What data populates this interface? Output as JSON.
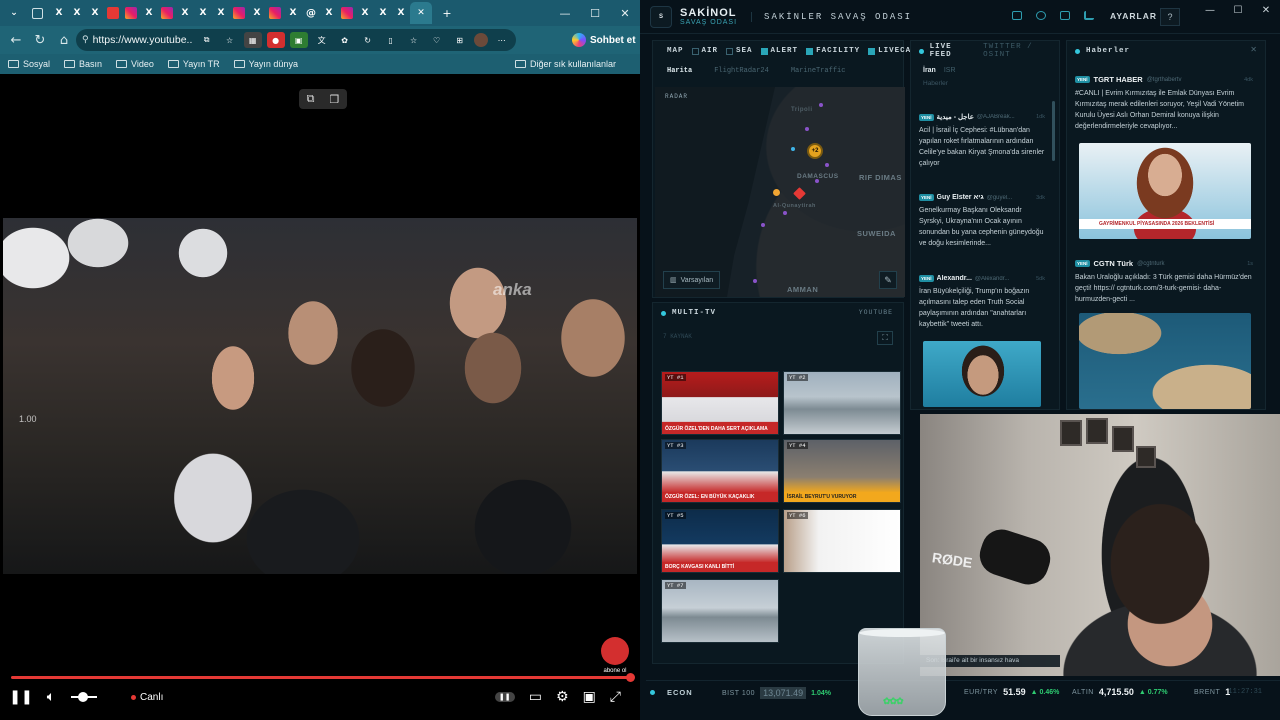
{
  "browser": {
    "tabs": [
      "window-menu",
      "workspaces",
      "x",
      "x",
      "x",
      "youtube",
      "instagram",
      "x",
      "instagram",
      "x",
      "x",
      "x",
      "instagram",
      "x",
      "instagram",
      "x",
      "threads",
      "x",
      "instagram",
      "x",
      "x",
      "x",
      "x",
      "x-active"
    ],
    "new_tab": "+",
    "window_controls": [
      "—",
      "☐",
      "✕"
    ],
    "url": "https://www.youtube...",
    "copilot_label": "Sohbet et",
    "bookmarks": [
      "Sosyal",
      "Basın",
      "Video",
      "Yayın TR",
      "Yayın dünya"
    ],
    "bookmarks_other": "Diğer sık kullanılanlar"
  },
  "video": {
    "speed_overlay": "1.00",
    "watermark": "anka",
    "logo_text": "abone ol",
    "live_label": "Canlı",
    "progress": 1.0,
    "volume": 0.45
  },
  "dashboard": {
    "brand": "SAKİNOL",
    "brand_sub": "SAVAŞ ODASI",
    "title": "SAKİNLER SAVAŞ ODASI",
    "settings": "AYARLAR",
    "help": "?",
    "map": {
      "title": "MAP",
      "filters": [
        {
          "label": "AIR",
          "on": false
        },
        {
          "label": "SEA",
          "on": false
        },
        {
          "label": "ALERT",
          "on": true
        },
        {
          "label": "FACILITY",
          "on": true
        },
        {
          "label": "LIVECAM",
          "on": true
        }
      ],
      "tabs": [
        "Harita",
        "FlightRadar24",
        "MarineTraffic"
      ],
      "radar_label": "RADAR",
      "cluster_label": "+2",
      "places": [
        "Tripoli",
        "DAMASCUS",
        "RIF DIMAS",
        "Al-Qunaytirah",
        "SUWEIDA",
        "AMMAN"
      ],
      "default_btn": "Varsayılan"
    },
    "multitv": {
      "title": "MULTI-TV",
      "source": "YOUTUBE",
      "count_label": "7 KAYNAK",
      "tiles": [
        {
          "tag": "YT #1",
          "strip": "ÖZGÜR ÖZEL'DEN DAHA SERT AÇIKLAMA"
        },
        {
          "tag": "YT #2",
          "strip": ""
        },
        {
          "tag": "YT #3",
          "strip": "ÖZGÜR ÖZEL: EN BÜYÜK KAÇAKLIK"
        },
        {
          "tag": "YT #4",
          "strip": "İSRAİL BEYRUT'U VURUYOR"
        },
        {
          "tag": "YT #5",
          "strip": "BORÇ KAVGASI KANLI BİTTİ"
        },
        {
          "tag": "YT #6",
          "strip": ""
        },
        {
          "tag": "YT #7",
          "strip": ""
        }
      ]
    },
    "feed": {
      "title": "LIVE FEED",
      "subtitle": "TWITTER / OSINT",
      "tabs": [
        "İran",
        "ISR"
      ],
      "filter": "Haberler",
      "posts": [
        {
          "badge": "YENİ",
          "name": "عاجل - ميدية",
          "handle": "@AJABreak...",
          "time": "1dk",
          "text": "Acil | İsrail İç Cephesi: #Lübnan'dan yapılan roket fırlatmalarının ardından Celile'ye bakan Kiryat Şmona'da sirenler çalıyor"
        },
        {
          "badge": "YENİ",
          "name": "Guy Elster גיא",
          "handle": "@guyel...",
          "time": "3dk",
          "text": "Genelkurmay Başkanı Oleksandr Syrskyi, Ukrayna'nın Ocak ayının sonundan bu yana cephenin güneydoğu ve doğu kesimlerinde..."
        },
        {
          "badge": "YENİ",
          "name": "Alexandr...",
          "handle": "@Alexandr...",
          "time": "5dk",
          "text": "İran Büyükelçiliği, Trump'ın boğazın açılmasını talep eden Truth Social paylaşımının ardından \"anahtarları kaybettik\" tweeti attı."
        }
      ]
    },
    "news": {
      "title": "Haberler",
      "posts": [
        {
          "badge": "YENİ",
          "name": "TGRT HABER",
          "handle": "@tgrthabertv",
          "time": "4dk",
          "text": "#CANLI | Evrim Kırmızıtaş ile Emlak Dünyası Evrim Kırmızıtaş merak edilenleri soruyor, Yeşil Vadi Yönetim Kurulu Üyesi Aslı Orhan Demiral konuya ilişkin değerlendirmeleriyle cevaplıyor...",
          "image_caption": "GAYRİMENKUL PİYASASINDA 2026 BEKLENTİSİ"
        },
        {
          "badge": "YENİ",
          "name": "CGTN Türk",
          "handle": "@cgtnturk",
          "time": "1s",
          "text": "Bakan Uraloğlu açıkladı: 3 Türk gemisi daha Hürmüz'den geçti! https:// cgtnturk.com/3-turk-gemisi- daha-hurmuzden-gecti ..."
        }
      ]
    },
    "webcam": {
      "mic_brand": "RØDE",
      "ticker": "Son: İsrail'e ait bir insansız hava"
    },
    "econ": {
      "title": "ECON",
      "quotes": [
        {
          "k": "BIST 100",
          "v": "13,071.49",
          "c": "1.04%"
        },
        {
          "k": "EUR/TRY",
          "v": "51.59",
          "c": "▲ 0.46%"
        },
        {
          "k": "ALTIN",
          "v": "4,715.50",
          "c": "▲ 0.77%"
        },
        {
          "k": "BRENT",
          "v": "1",
          "c": ""
        }
      ],
      "clock": "11:27:31"
    },
    "colors": {
      "accent": "#34c7dc",
      "up": "#2ecc71",
      "alert": "#e53935",
      "bg": "#07121a"
    }
  }
}
